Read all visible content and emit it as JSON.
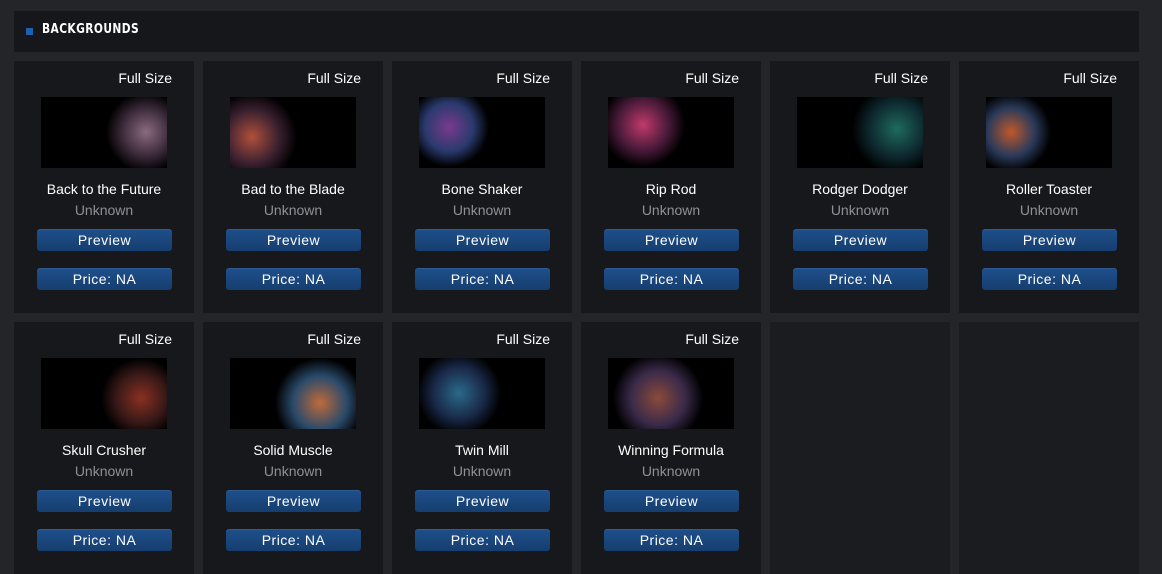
{
  "header": {
    "title": "BACKGROUNDS"
  },
  "labels": {
    "full_size": "Full Size",
    "preview": "Preview",
    "price": "Price: NA"
  },
  "colors": {
    "accent": "#1f5fb0",
    "button": "#1a4a84",
    "card_bg": "#16181b",
    "page_bg": "#232529"
  },
  "items": [
    {
      "name": "Back to the Future",
      "author": "Unknown",
      "thumb_colors": [
        "#8a6b7f",
        "#3b2a3a"
      ]
    },
    {
      "name": "Bad to the Blade",
      "author": "Unknown",
      "thumb_colors": [
        "#b0503a",
        "#3a2030"
      ]
    },
    {
      "name": "Bone Shaker",
      "author": "Unknown",
      "thumb_colors": [
        "#7a3a8e",
        "#2a3a6e"
      ]
    },
    {
      "name": "Rip Rod",
      "author": "Unknown",
      "thumb_colors": [
        "#c03a6a",
        "#4a1a3a"
      ]
    },
    {
      "name": "Rodger Dodger",
      "author": "Unknown",
      "thumb_colors": [
        "#1e6b5e",
        "#0e2a30"
      ]
    },
    {
      "name": "Roller Toaster",
      "author": "Unknown",
      "thumb_colors": [
        "#c0582a",
        "#2a3a5a"
      ]
    },
    {
      "name": "Skull Crusher",
      "author": "Unknown",
      "thumb_colors": [
        "#8a3020",
        "#3a1a18"
      ]
    },
    {
      "name": "Solid Muscle",
      "author": "Unknown",
      "thumb_colors": [
        "#c06a3a",
        "#2a4a6a"
      ]
    },
    {
      "name": "Twin Mill",
      "author": "Unknown",
      "thumb_colors": [
        "#2a6a8a",
        "#1a2a4a"
      ]
    },
    {
      "name": "Winning Formula",
      "author": "Unknown",
      "thumb_colors": [
        "#8a4a3a",
        "#3a2a4a"
      ]
    }
  ]
}
